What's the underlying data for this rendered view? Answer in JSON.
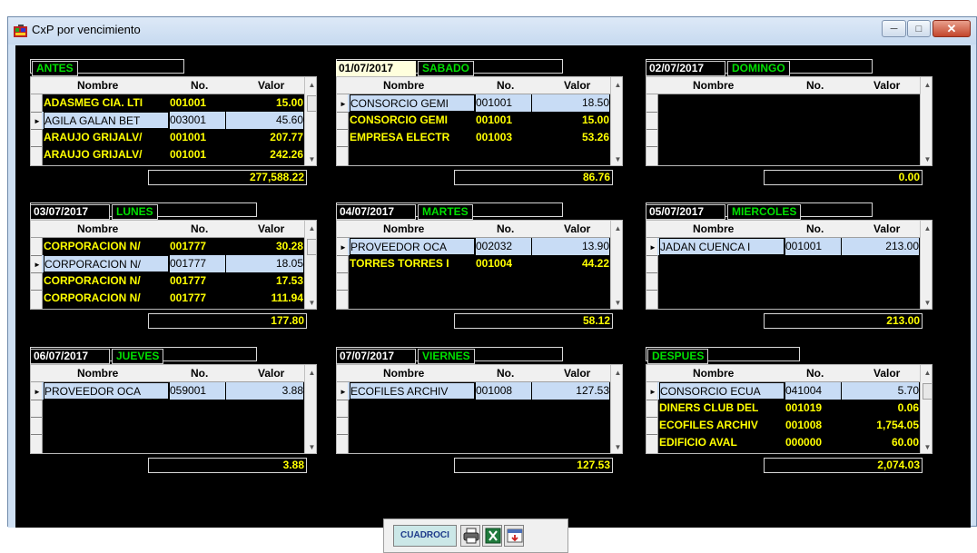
{
  "window": {
    "title": "CxP por vencimiento"
  },
  "columns": {
    "nombre": "Nombre",
    "no": "No.",
    "valor": "Valor"
  },
  "panels": [
    {
      "date": "",
      "day": "ANTES",
      "total": "277,588.22",
      "rows": [
        {
          "nombre": "ADASMEG CIA. LTI",
          "no": "001001",
          "valor": "15.00",
          "selected": false
        },
        {
          "nombre": "AGILA GALAN BET",
          "no": "003001",
          "valor": "45.60",
          "selected": true
        },
        {
          "nombre": "ARAUJO GRIJALV/",
          "no": "001001",
          "valor": "207.77",
          "selected": false
        },
        {
          "nombre": "ARAUJO GRIJALV/",
          "no": "001001",
          "valor": "242.26",
          "selected": false
        }
      ]
    },
    {
      "date": "01/07/2017",
      "day": "SABADO",
      "total": "86.76",
      "rows": [
        {
          "nombre": "CONSORCIO GEMI",
          "no": "001001",
          "valor": "18.50",
          "selected": true
        },
        {
          "nombre": "CONSORCIO GEMI",
          "no": "001001",
          "valor": "15.00",
          "selected": false
        },
        {
          "nombre": "EMPRESA ELECTR",
          "no": "001003",
          "valor": "53.26",
          "selected": false
        }
      ]
    },
    {
      "date": "02/07/2017",
      "day": "DOMINGO",
      "total": "0.00",
      "rows": []
    },
    {
      "date": "03/07/2017",
      "day": "LUNES",
      "total": "177.80",
      "rows": [
        {
          "nombre": "CORPORACION N/",
          "no": "001777",
          "valor": "30.28",
          "selected": false
        },
        {
          "nombre": "CORPORACION N/",
          "no": "001777",
          "valor": "18.05",
          "selected": true
        },
        {
          "nombre": "CORPORACION N/",
          "no": "001777",
          "valor": "17.53",
          "selected": false
        },
        {
          "nombre": "CORPORACION N/",
          "no": "001777",
          "valor": "111.94",
          "selected": false
        }
      ]
    },
    {
      "date": "04/07/2017",
      "day": "MARTES",
      "total": "58.12",
      "rows": [
        {
          "nombre": "PROVEEDOR OCA",
          "no": "002032",
          "valor": "13.90",
          "selected": true
        },
        {
          "nombre": "TORRES TORRES I",
          "no": "001004",
          "valor": "44.22",
          "selected": false
        }
      ]
    },
    {
      "date": "05/07/2017",
      "day": "MIERCOLES",
      "total": "213.00",
      "rows": [
        {
          "nombre": "JADAN CUENCA I",
          "no": "001001",
          "valor": "213.00",
          "selected": true
        }
      ]
    },
    {
      "date": "06/07/2017",
      "day": "JUEVES",
      "total": "3.88",
      "rows": [
        {
          "nombre": "PROVEEDOR OCA",
          "no": "059001",
          "valor": "3.88",
          "selected": true
        }
      ]
    },
    {
      "date": "07/07/2017",
      "day": "VIERNES",
      "total": "127.53",
      "rows": [
        {
          "nombre": "ECOFILES ARCHIV",
          "no": "001008",
          "valor": "127.53",
          "selected": true
        }
      ]
    },
    {
      "date": "",
      "day": "DESPUES",
      "total": "2,074.03",
      "rows": [
        {
          "nombre": "CONSORCIO ECUA",
          "no": "041004",
          "valor": "5.70",
          "selected": true
        },
        {
          "nombre": "DINERS CLUB DEL",
          "no": "001019",
          "valor": "0.06",
          "selected": false
        },
        {
          "nombre": "ECOFILES ARCHIV",
          "no": "001008",
          "valor": "1,754.05",
          "selected": false
        },
        {
          "nombre": "EDIFICIO AVAL",
          "no": "000000",
          "valor": "60.00",
          "selected": false
        }
      ]
    }
  ],
  "toolbar": {
    "cuadre_label": "CUADROCI",
    "icons": [
      "printer-icon",
      "excel-icon",
      "export-icon"
    ]
  },
  "colors": {
    "row_text": "#ffff00",
    "day_text": "#00e000",
    "selected_row": "#c8dcf5",
    "background": "#000000"
  }
}
